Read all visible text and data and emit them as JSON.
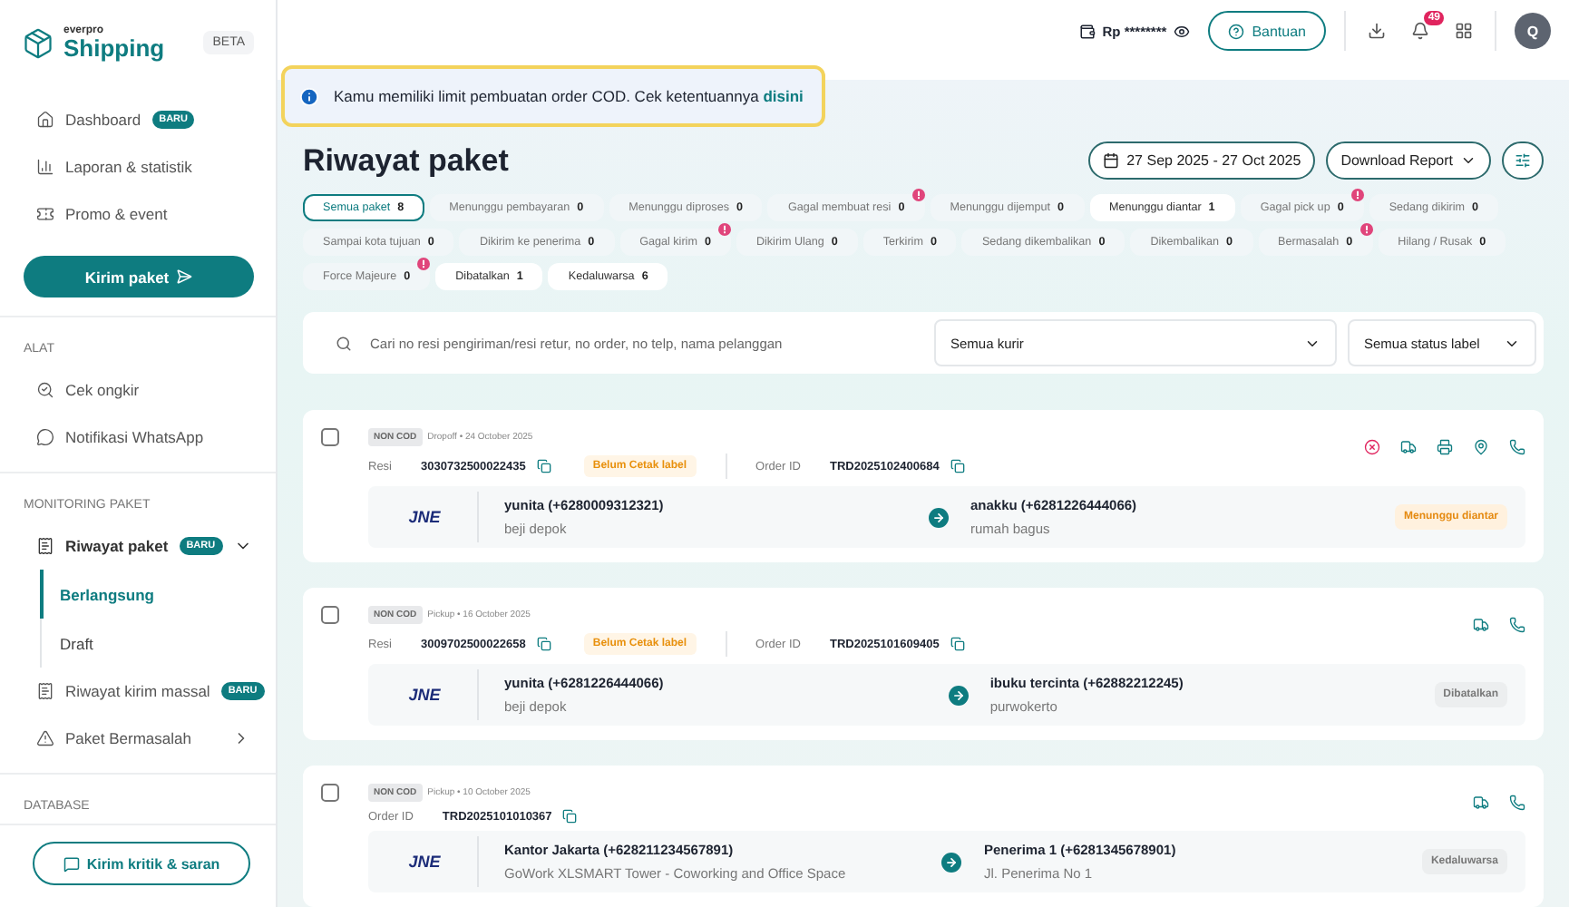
{
  "brand": {
    "over": "everpro",
    "name": "Shipping",
    "tag": "BETA"
  },
  "sidebar": {
    "top_items": [
      {
        "kind": "home",
        "label": "Dashboard",
        "badge": "BARU"
      },
      {
        "kind": "chart",
        "label": "Laporan & statistik"
      },
      {
        "kind": "ticket",
        "label": "Promo & event"
      }
    ],
    "primary_button": "Kirim paket",
    "sections": [
      {
        "title": "ALAT",
        "items": [
          {
            "kind": "search-list",
            "label": "Cek ongkir"
          },
          {
            "kind": "whatsapp",
            "label": "Notifikasi WhatsApp"
          }
        ]
      },
      {
        "title": "MONITORING PAKET",
        "items": [
          {
            "kind": "receipt",
            "label": "Riwayat paket",
            "badge": "BARU",
            "expanded": true,
            "children": [
              {
                "label": "Berlangsung",
                "selected": true
              },
              {
                "label": "Draft",
                "selected": false
              }
            ]
          },
          {
            "kind": "receipt",
            "label": "Riwayat kirim massal",
            "badge": "BARU"
          },
          {
            "kind": "warning",
            "label": "Paket Bermasalah",
            "expanded": false
          }
        ]
      },
      {
        "title": "DATABASE"
      }
    ],
    "feedback_button": "Kirim kritik & saran"
  },
  "topbar": {
    "balance": "Rp ********",
    "help": "Bantuan",
    "notifications": "49",
    "avatar": "Q"
  },
  "banner": {
    "text": "Kamu memiliki limit pembuatan order COD. Cek ketentuannya **disini**"
  },
  "page": {
    "title": "Riwayat paket",
    "date_range": "27 Sep 2025 - 27 Oct 2025",
    "download": "Download Report"
  },
  "chips": [
    {
      "label": "Semua paket",
      "count": "8",
      "selected": true,
      "alert": false,
      "filled": false
    },
    {
      "label": "Menunggu pembayaran",
      "count": "0",
      "selected": false,
      "alert": false,
      "filled": false
    },
    {
      "label": "Menunggu diproses",
      "count": "0",
      "selected": false,
      "alert": false,
      "filled": false
    },
    {
      "label": "Gagal membuat resi",
      "count": "0",
      "selected": false,
      "alert": true,
      "filled": false
    },
    {
      "label": "Menunggu dijemput",
      "count": "0",
      "selected": false,
      "alert": false,
      "filled": false
    },
    {
      "label": "Menunggu diantar",
      "count": "1",
      "selected": false,
      "alert": false,
      "filled": true
    },
    {
      "label": "Gagal pick up",
      "count": "0",
      "selected": false,
      "alert": true,
      "filled": false
    },
    {
      "label": "Sedang dikirim",
      "count": "0",
      "selected": false,
      "alert": false,
      "filled": false
    },
    {
      "label": "Sampai kota tujuan",
      "count": "0",
      "selected": false,
      "alert": false,
      "filled": false
    },
    {
      "label": "Dikirim ke penerima",
      "count": "0",
      "selected": false,
      "alert": false,
      "filled": false
    },
    {
      "label": "Gagal kirim",
      "count": "0",
      "selected": false,
      "alert": true,
      "filled": false
    },
    {
      "label": "Dikirim Ulang",
      "count": "0",
      "selected": false,
      "alert": false,
      "filled": false
    },
    {
      "label": "Terkirim",
      "count": "0",
      "selected": false,
      "alert": false,
      "filled": false
    },
    {
      "label": "Sedang dikembalikan",
      "count": "0",
      "selected": false,
      "alert": false,
      "filled": false
    },
    {
      "label": "Dikembalikan",
      "count": "0",
      "selected": false,
      "alert": false,
      "filled": false
    },
    {
      "label": "Bermasalah",
      "count": "0",
      "selected": false,
      "alert": true,
      "filled": false
    },
    {
      "label": "Hilang / Rusak",
      "count": "0",
      "selected": false,
      "alert": false,
      "filled": false
    },
    {
      "label": "Force Majeure",
      "count": "0",
      "selected": false,
      "alert": true,
      "filled": false
    },
    {
      "label": "Dibatalkan",
      "count": "1",
      "selected": false,
      "alert": false,
      "filled": true
    },
    {
      "label": "Kedaluwarsa",
      "count": "6",
      "selected": false,
      "alert": false,
      "filled": true
    }
  ],
  "search": {
    "placeholder": "Cari no resi pengiriman/resi retur, no order, no telp, nama pelanggan",
    "courier": "Semua kurir",
    "label_status": "Semua status label"
  },
  "shipments": [
    {
      "checked": false,
      "type": "NON COD",
      "meta": "Dropoff • 24 October 2025",
      "resi_label": "Resi",
      "resi": "3030732500022435",
      "label_state": "Belum Cetak label",
      "order_label": "Order ID",
      "order_id": "TRD2025102400684",
      "courier": "JNE",
      "sender": "yunita (+6280009312321)",
      "sender_address": "beji depok",
      "receiver": "anakku (+6281226444066)",
      "receiver_address": "rumah bagus",
      "status": {
        "text": "Menunggu diantar",
        "kind": "warning"
      },
      "actions": [
        {
          "kind": "cancel"
        },
        {
          "kind": "track"
        },
        {
          "kind": "print"
        },
        {
          "kind": "locate"
        },
        {
          "kind": "whatsapp"
        }
      ]
    },
    {
      "checked": false,
      "type": "NON COD",
      "meta": "Pickup • 16 October 2025",
      "resi_label": "Resi",
      "resi": "3009702500022658",
      "label_state": "Belum Cetak label",
      "order_label": "Order ID",
      "order_id": "TRD2025101609405",
      "courier": "JNE",
      "sender": "yunita (+6281226444066)",
      "sender_address": "beji depok",
      "receiver": "ibuku tercinta (+62882212245)",
      "receiver_address": "purwokerto",
      "status": {
        "text": "Dibatalkan",
        "kind": "neutral"
      },
      "actions": [
        {
          "kind": "track"
        },
        {
          "kind": "whatsapp"
        }
      ]
    },
    {
      "checked": false,
      "type": "NON COD",
      "meta": "Pickup • 10 October 2025",
      "order_label": "Order ID",
      "order_id": "TRD2025101010367",
      "courier": "JNE",
      "sender": "Kantor Jakarta (+628211234567891)",
      "sender_address": "GoWork XLSMART Tower - Coworking and Office Space",
      "receiver": "Penerima 1 (+6281345678901)",
      "receiver_address": "Jl. Penerima No 1",
      "status": {
        "text": "Kedaluwarsa",
        "kind": "neutral"
      },
      "actions": [
        {
          "kind": "track"
        },
        {
          "kind": "whatsapp"
        }
      ]
    }
  ]
}
